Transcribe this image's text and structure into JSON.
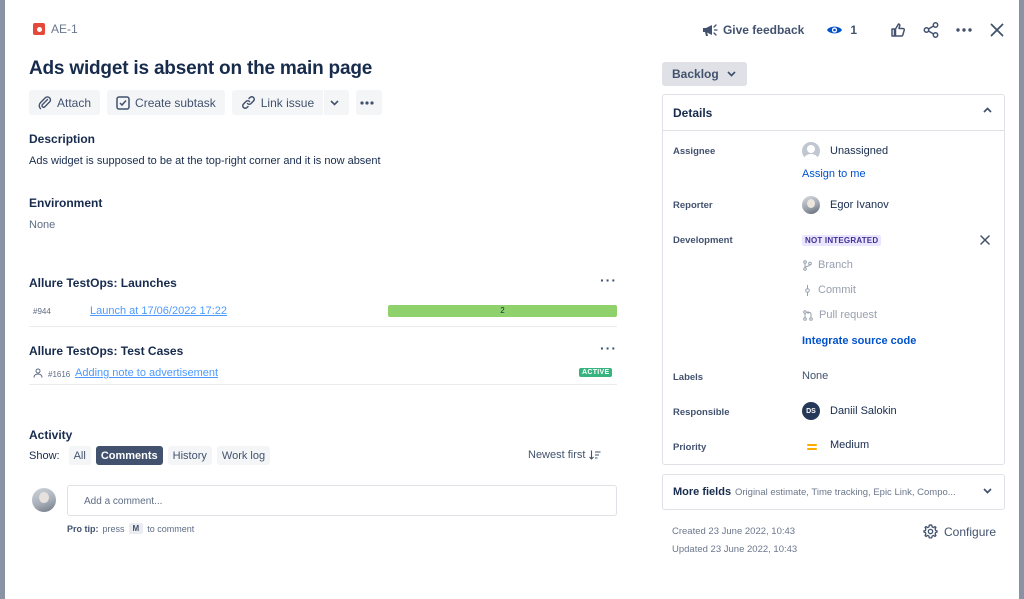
{
  "issue": {
    "key": "AE-1",
    "title": "Ads widget is absent on the main page"
  },
  "top_actions": {
    "give_feedback": "Give feedback",
    "watch_count": "1"
  },
  "toolbar": {
    "attach": "Attach",
    "create_subtask": "Create subtask",
    "link_issue": "Link issue"
  },
  "description": {
    "heading": "Description",
    "text": "Ads widget is supposed to be at the top-right corner and it is now absent"
  },
  "environment": {
    "heading": "Environment",
    "text": "None"
  },
  "launches": {
    "heading": "Allure TestOps: Launches",
    "items": [
      {
        "number": "#944",
        "link": "Launch at 17/06/2022 17:22",
        "count": "2",
        "progress": 1.0
      }
    ]
  },
  "test_cases": {
    "heading": "Allure TestOps: Test Cases",
    "items": [
      {
        "number": "#1616",
        "link": "Adding note to advertisement",
        "status": "ACTIVE"
      }
    ]
  },
  "activity": {
    "heading": "Activity",
    "show_label": "Show:",
    "filters": [
      "All",
      "Comments",
      "History",
      "Work log"
    ],
    "active_filter": "Comments",
    "sort": "Newest first",
    "comment_placeholder": "Add a comment...",
    "protip_label": "Pro tip:",
    "protip_press": "press",
    "protip_key": "M",
    "protip_rest": "to comment"
  },
  "status": {
    "label": "Backlog"
  },
  "details": {
    "heading": "Details",
    "assignee_label": "Assignee",
    "assignee_value": "Unassigned",
    "assign_to_me": "Assign to me",
    "reporter_label": "Reporter",
    "reporter_value": "Egor Ivanov",
    "development_label": "Development",
    "development_badge": "NOT INTEGRATED",
    "dev_items": [
      "Branch",
      "Commit",
      "Pull request"
    ],
    "integrate": "Integrate source code",
    "labels_label": "Labels",
    "labels_value": "None",
    "responsible_label": "Responsible",
    "responsible_initials": "DS",
    "responsible_value": "Daniil Salokin",
    "priority_label": "Priority",
    "priority_value": "Medium"
  },
  "more_fields": {
    "title": "More fields",
    "subtitle": "Original estimate, Time tracking, Epic Link, Compo..."
  },
  "meta": {
    "created": "Created 23 June 2022, 10:43",
    "updated": "Updated 23 June 2022, 10:43",
    "configure": "Configure"
  },
  "colors": {
    "bug": "#e5493a",
    "link": "#0052cc",
    "progress": "#8fd16b",
    "active_badge": "#36b37e",
    "not_integrated_bg": "#eae6ff",
    "priority_medium": "#ffab00"
  }
}
